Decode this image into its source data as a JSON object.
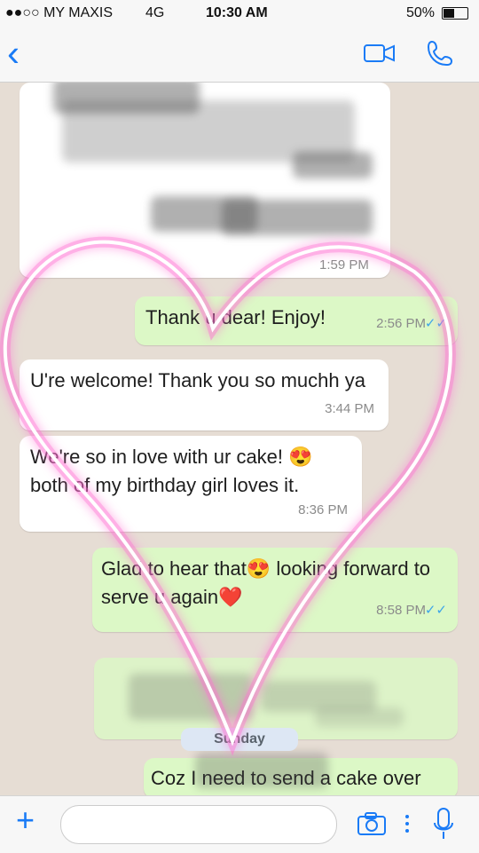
{
  "status_bar": {
    "carrier": "●●○○ MY MAXIS",
    "network": "4G",
    "time": "10:30 AM",
    "battery": "50%"
  },
  "chat": {
    "messages": [
      {
        "type": "incoming",
        "text": "U're welcome! Thank you so muchh ya",
        "time": "3:44 PM"
      },
      {
        "type": "incoming",
        "text": "We're so in love with ur cake! 😍 both of my birthday girl loves it.",
        "time": "8:36 PM"
      },
      {
        "type": "outgoing",
        "text": "Glad to hear that😍 looking forward to serve u again❤️",
        "time": "8:58 PM"
      },
      {
        "type": "outgoing",
        "text": "Thank u dear! Enjoy!",
        "time": "2:56 PM"
      },
      {
        "type": "outgoing",
        "text": "Coz I need to send a cake over",
        "time": ""
      }
    ],
    "date_divider": "Sunday",
    "partial_time": "1:59 PM"
  },
  "colors": {
    "accent": "#1a7bf6",
    "incoming_bubble": "#ffffff",
    "outgoing_bubble": "#dcf8c6",
    "heart": "#ff6fd1"
  },
  "icons": [
    "back-icon",
    "video-call-icon",
    "phone-icon",
    "scroll-down-icon",
    "plus-icon",
    "camera-icon",
    "more-icon",
    "microphone-icon"
  ]
}
